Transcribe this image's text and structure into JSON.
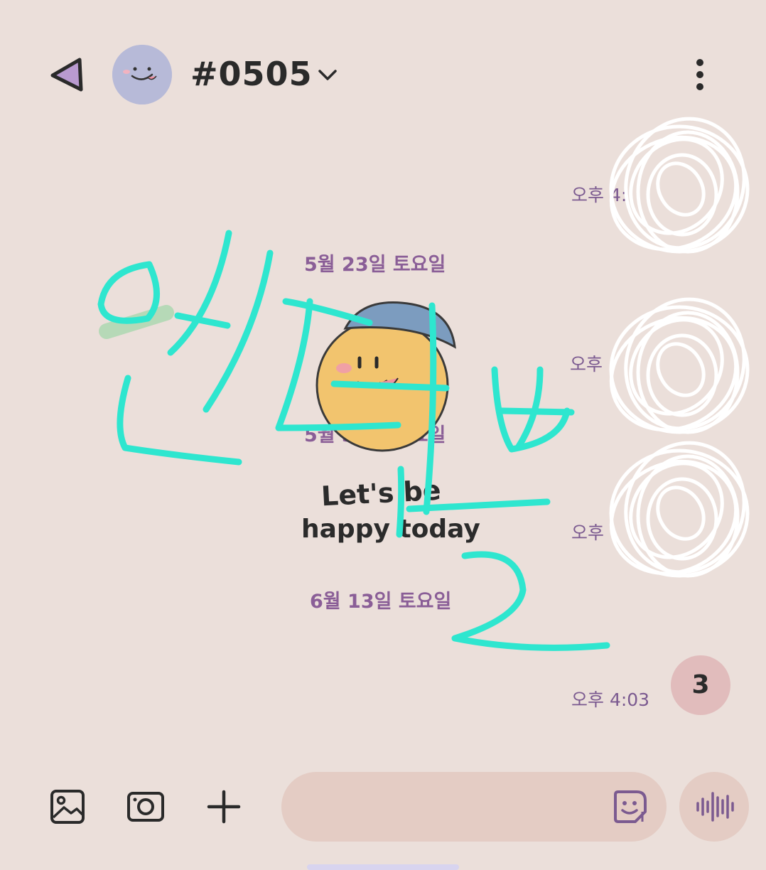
{
  "header": {
    "title": "#0505",
    "back_icon": "back-triangle-icon",
    "avatar_icon": "smiley-face-avatar",
    "dropdown_icon": "chevron-down-icon",
    "menu_icon": "more-vertical-icon"
  },
  "messages": {
    "time_1": "오후 4:",
    "time_2": "오후",
    "time_3": "오후",
    "time_4": "오후 4:03",
    "dates": [
      "5월 23일 토요일",
      "5월 30일 토요일",
      "6월 13일 토요일"
    ],
    "sticker_text": [
      "Let's be",
      "happy today"
    ],
    "unread_count": "3"
  },
  "overlay": {
    "handwriting_text": "안녕하세요"
  },
  "input_bar": {
    "gallery_icon": "image-icon",
    "camera_icon": "camera-icon",
    "plus_icon": "plus-icon",
    "emoji_icon": "sticker-emoji-icon",
    "voice_icon": "voice-waveform-icon",
    "placeholder": ""
  },
  "colors": {
    "background": "#ebdfda",
    "accent_purple": "#8a5e97",
    "input_bg": "#e4ccc4",
    "badge_bg": "#e1bcbc",
    "handwriting": "#2ee6cf"
  }
}
